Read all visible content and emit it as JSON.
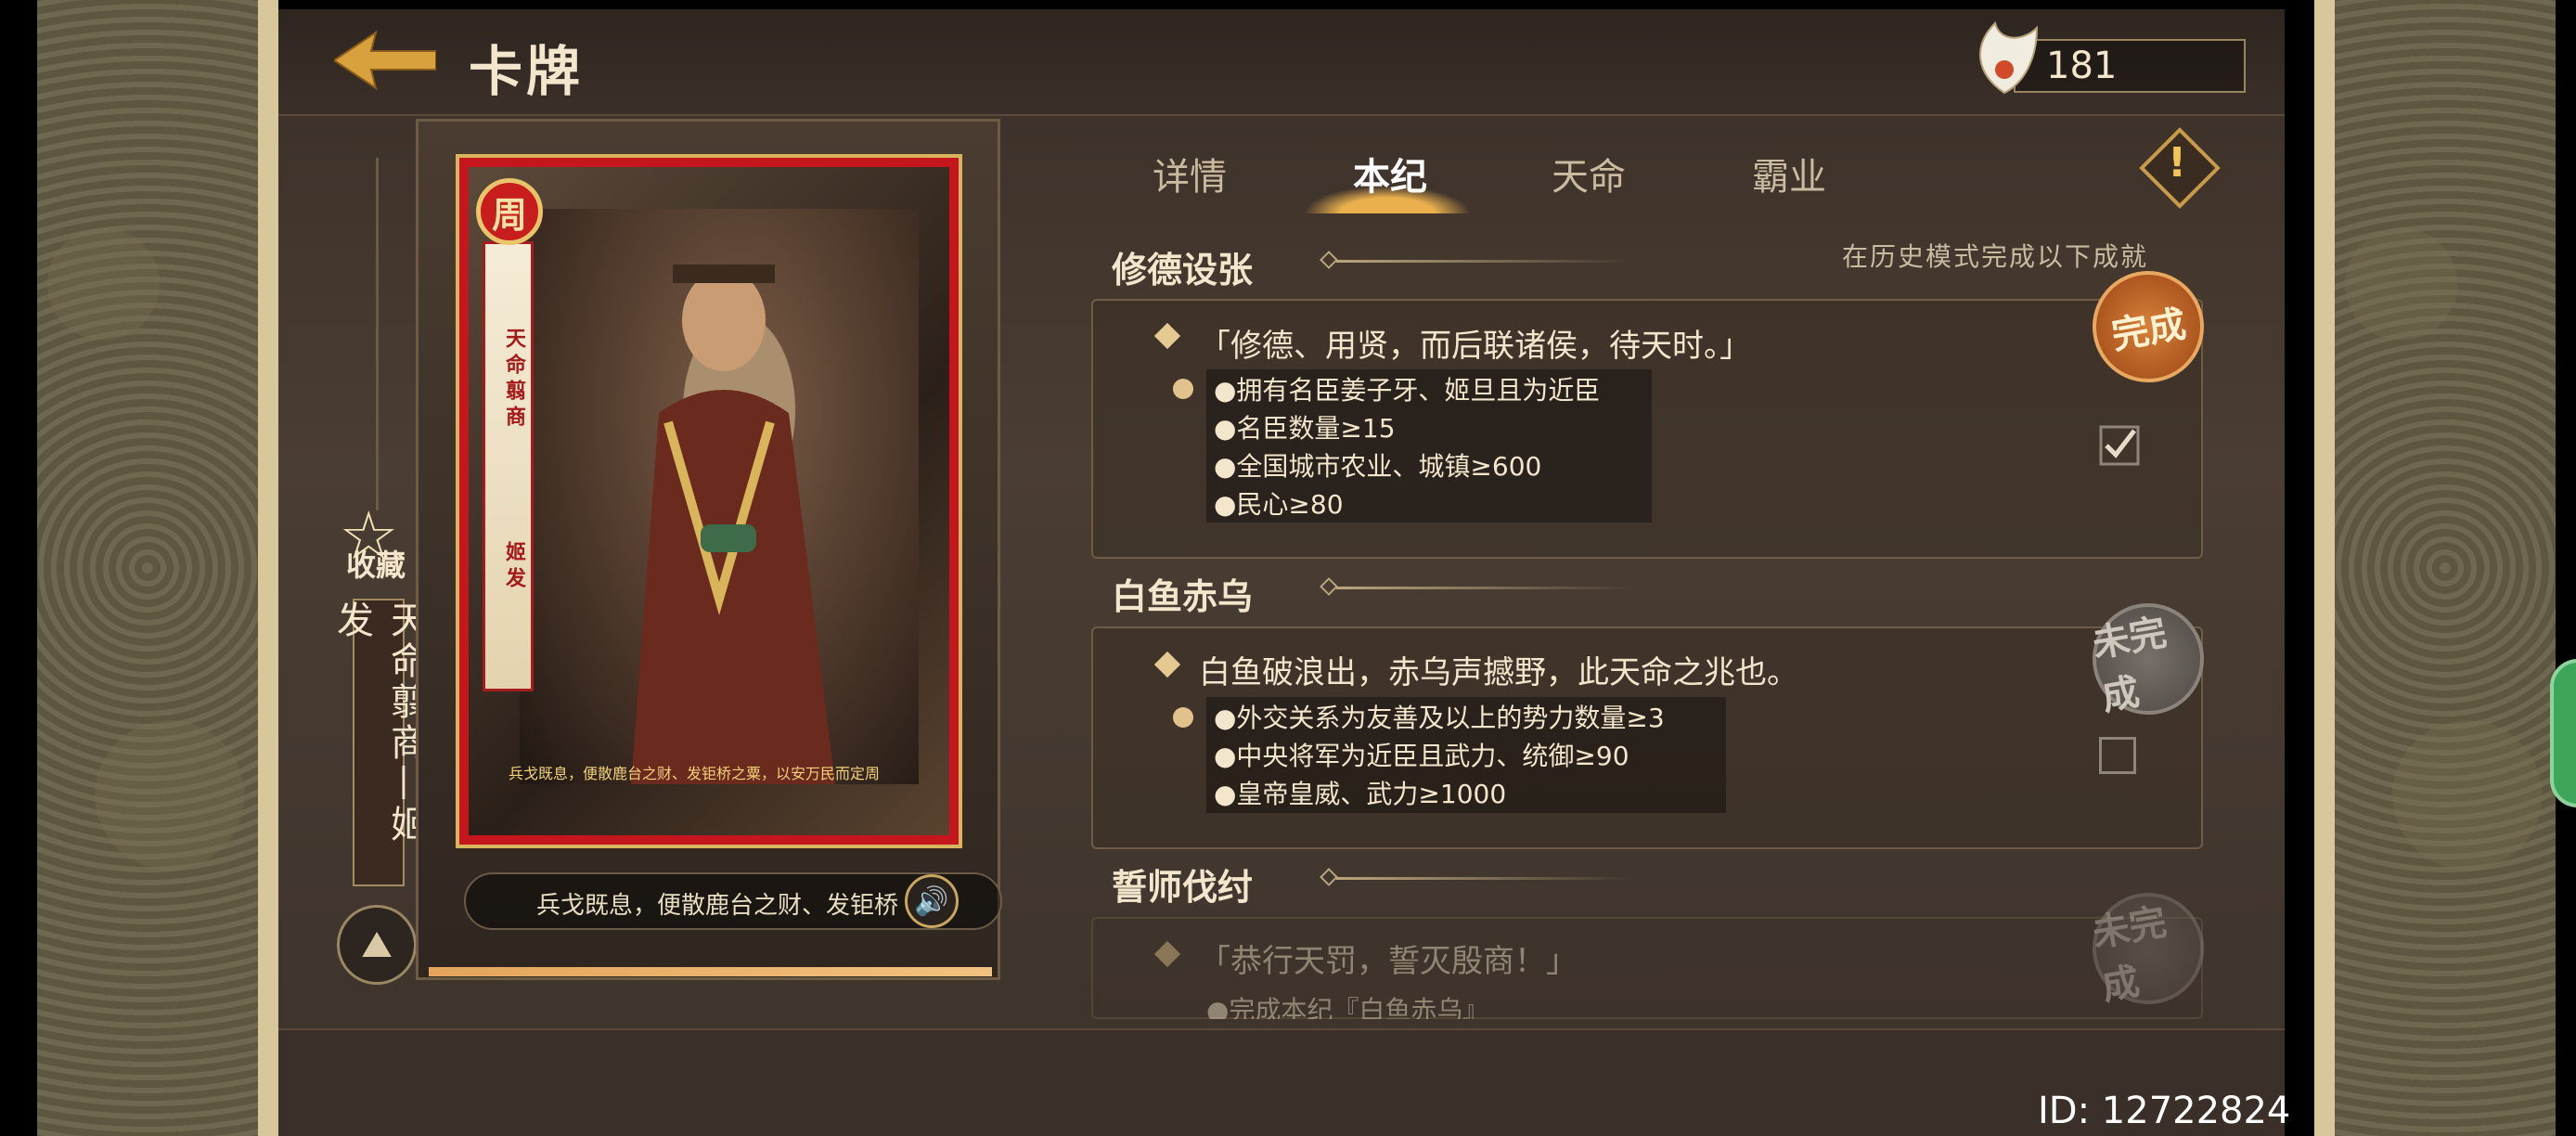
{
  "header": {
    "title": "卡牌",
    "currency_value": "181"
  },
  "card": {
    "seal_char": "周",
    "ribbon_title": "天命翦商",
    "ribbon_name": "姬发",
    "quote": "兵戈既息，便散鹿台之财、发钜桥之粟，以安万民而定周",
    "audio_text": "兵戈既息，便散鹿台之财、发钜桥之粟"
  },
  "sidebar": {
    "collect_label": "收藏",
    "name_vertical": "天命翦商—姬发"
  },
  "tabs": [
    {
      "label": "详情",
      "active": false
    },
    {
      "label": "本纪",
      "active": true
    },
    {
      "label": "天命",
      "active": false
    },
    {
      "label": "霸业",
      "active": false
    }
  ],
  "hint": "在历史模式完成以下成就",
  "sections": [
    {
      "title": "修德设张",
      "quote": "「修德、用贤，而后联诸侯，待天时。」",
      "requirements": [
        "●拥有名臣姜子牙、姬旦且为近臣",
        "●名臣数量≥15",
        "●全国城市农业、城镇≥600",
        "●民心≥80"
      ],
      "status": "完成",
      "completed": true
    },
    {
      "title": "白鱼赤乌",
      "quote": "白鱼破浪出，赤乌声撼野，此天命之兆也。",
      "requirements": [
        "●外交关系为友善及以上的势力数量≥3",
        "●中央将军为近臣且武力、统御≥90",
        "●皇帝皇威、武力≥1000"
      ],
      "status": "未完成",
      "completed": false
    },
    {
      "title": "誓师伐纣",
      "quote": "「恭行天罚，誓灭殷商！」",
      "requirements": [
        "●完成本纪『白鱼赤乌』"
      ],
      "status": "未完成",
      "completed": false
    }
  ],
  "footer": {
    "id_label": "ID: 12722824"
  },
  "colors": {
    "accent_gold": "#e4c990",
    "card_red": "#c4161c",
    "done_orange": "#d6813a"
  },
  "icons": [
    "back-arrow-icon",
    "plume-icon",
    "alert-icon",
    "star-icon",
    "mountain-icon",
    "speaker-icon",
    "checkbox-icon"
  ]
}
